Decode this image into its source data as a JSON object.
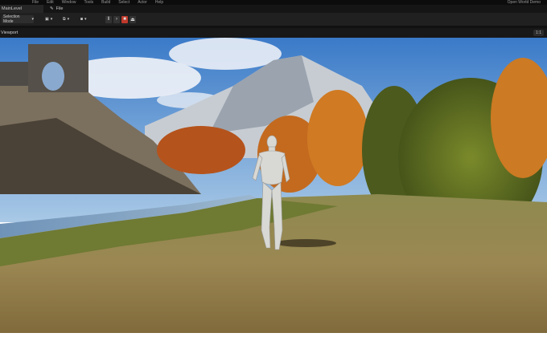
{
  "menubar": {
    "items": [
      "File",
      "Edit",
      "Window",
      "Tools",
      "Build",
      "Select",
      "Actor",
      "Help"
    ],
    "project_name": "Open World Demo"
  },
  "tabbar": {
    "tab_label": "MainLevel",
    "file_label": "File"
  },
  "toolbar": {
    "mode_label": "Selection Mode",
    "play_controls": [
      "pause",
      "frame-step",
      "stop",
      "eject"
    ]
  },
  "viewport": {
    "label": "Viewport",
    "zoom_label": "1:1"
  },
  "debug": {
    "message": ""
  }
}
